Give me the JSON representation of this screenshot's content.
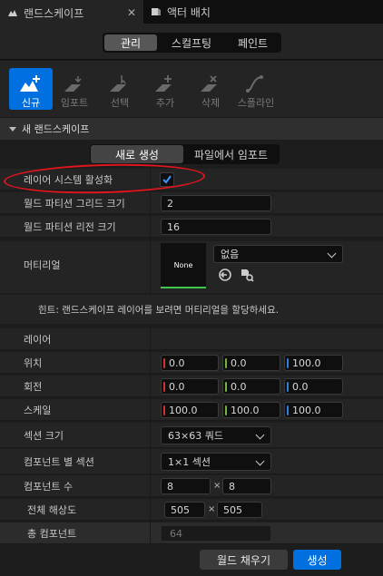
{
  "tabs": [
    {
      "label": "랜드스케이프",
      "close": "✕"
    },
    {
      "label": "액터 배치"
    }
  ],
  "modes": [
    "관리",
    "스컬프팅",
    "페인트"
  ],
  "tools": [
    "신규",
    "임포트",
    "선택",
    "추가",
    "삭제",
    "스플라인"
  ],
  "section_title": "새 랜드스케이프",
  "create_mode": {
    "new": "새로 생성",
    "import": "파일에서 임포트"
  },
  "fields": {
    "enable_layer_system": {
      "label": "레이어 시스템 활성화",
      "checked": true
    },
    "world_partition_grid": {
      "label": "월드 파티션 그리드 크기",
      "value": "2"
    },
    "world_partition_region": {
      "label": "월드 파티션 리전 크기",
      "value": "16"
    },
    "material": {
      "label": "머티리얼",
      "thumb": "None",
      "value": "없음"
    },
    "hint": "힌트: 랜드스케이프 레이어를 보려면 머티리얼을 할당하세요.",
    "layers": {
      "label": "레이어"
    },
    "location": {
      "label": "위치",
      "x": "0.0",
      "y": "0.0",
      "z": "100.0"
    },
    "rotation": {
      "label": "회전",
      "x": "0.0",
      "y": "0.0",
      "z": "0.0"
    },
    "scale": {
      "label": "스케일",
      "x": "100.0",
      "y": "100.0",
      "z": "100.0"
    },
    "section_size": {
      "label": "섹션 크기",
      "value": "63×63 쿼드"
    },
    "sections_per_component": {
      "label": "컴포넌트 별 섹션",
      "value": "1×1 섹션"
    },
    "component_count": {
      "label": "컴포넌트 수",
      "x": "8",
      "y": "8"
    },
    "overall_resolution": {
      "label": "전체 해상도",
      "x": "505",
      "y": "505"
    },
    "total_components": {
      "label": "총 컴포넌트",
      "value": "64"
    }
  },
  "times_symbol": "×",
  "buttons": {
    "fill_world": "월드 채우기",
    "create": "생성"
  },
  "colors": {
    "accent": "#0070e0",
    "axis_x": "#d0342c",
    "axis_y": "#6fb63a",
    "axis_z": "#2f7fe0",
    "annotation": "#e0161e"
  }
}
